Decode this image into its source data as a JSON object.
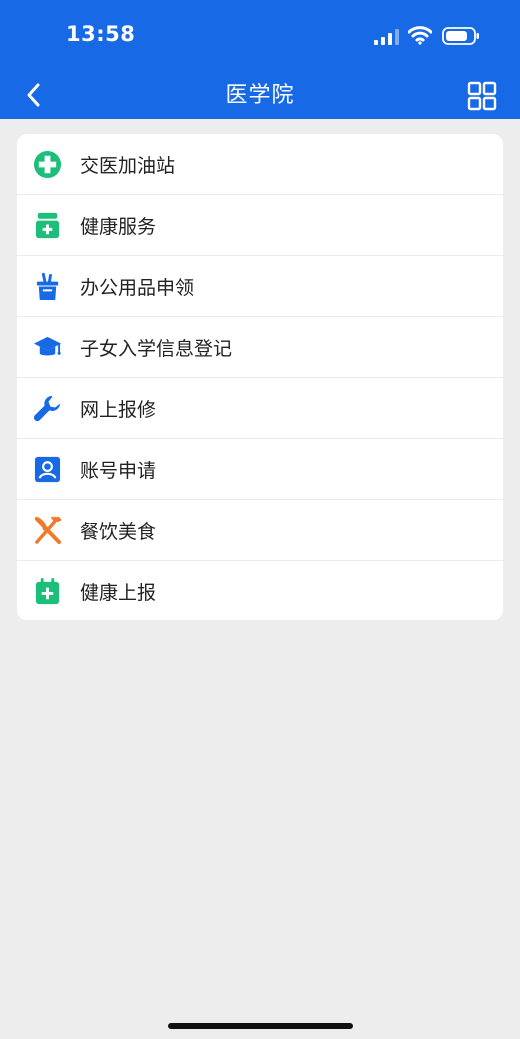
{
  "status_bar": {
    "time": "13:58"
  },
  "nav": {
    "title": "医学院",
    "back_icon": "chevron-left-icon",
    "menu_icon": "grid-icon"
  },
  "colors": {
    "primary": "#1769e6",
    "green": "#1cbe7a",
    "orange": "#f07a2c",
    "background": "#ededed"
  },
  "menu": {
    "items": [
      {
        "label": "交医加油站",
        "icon": "medical-cross-icon"
      },
      {
        "label": "健康服务",
        "icon": "medicine-box-icon"
      },
      {
        "label": "办公用品申领",
        "icon": "pen-holder-icon"
      },
      {
        "label": "子女入学信息登记",
        "icon": "graduation-cap-icon"
      },
      {
        "label": "网上报修",
        "icon": "wrench-icon"
      },
      {
        "label": "账号申请",
        "icon": "user-account-icon"
      },
      {
        "label": "餐饮美食",
        "icon": "fork-knife-icon"
      },
      {
        "label": "健康上报",
        "icon": "calendar-plus-icon"
      }
    ]
  }
}
